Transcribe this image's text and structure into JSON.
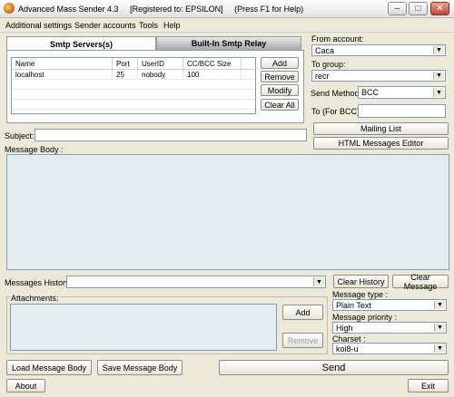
{
  "window": {
    "title": "Advanced Mass Sender 4.3     [Registered to: EPSILON]     (Press F1 for Help)",
    "min_glyph": "–",
    "max_glyph": "□",
    "close_glyph": "✕"
  },
  "menu": [
    "Additional settings",
    "Sender accounts",
    "Tools",
    "Help"
  ],
  "tabs": {
    "smtp_servers": "Smtp Servers(s)",
    "builtin_relay": "Built-In Smtp Relay"
  },
  "smtp_table": {
    "columns": [
      "Name",
      "Port",
      "UserID",
      "CC/BCC Size"
    ],
    "rows": [
      [
        "localhost",
        "25",
        "nobody",
        "100"
      ]
    ]
  },
  "smtp_buttons": {
    "add": "Add",
    "remove": "Remove",
    "modify": "Modify",
    "clear_all": "Clear All"
  },
  "right": {
    "from_account_label": "From account:",
    "from_account_value": "Caca",
    "to_group_label": "To group:",
    "to_group_value": "recr",
    "send_method_label": "Send Method:",
    "send_method_value": "BCC",
    "to_bcc_label": "To (For BCC):",
    "to_bcc_value": "",
    "mailing_list": "Mailing List",
    "html_editor": "HTML Messages Editor"
  },
  "subject": {
    "label": "Subject:",
    "value": ""
  },
  "message_body_label": "Message Body :",
  "history": {
    "label": "Messages History:",
    "value": "",
    "clear_history": "Clear History",
    "clear_message": "Clear Message"
  },
  "attachments": {
    "label": "Attachments:",
    "add": "Add",
    "remove": "Remove"
  },
  "message_type": {
    "label": "Message type :",
    "value": "Plain Text"
  },
  "message_priority": {
    "label": "Message priority :",
    "value": "High"
  },
  "charset": {
    "label": "Charset :",
    "value": "koi8-u"
  },
  "bottom": {
    "load": "Load Message Body",
    "save": "Save Message Body",
    "send": "Send",
    "about": "About",
    "exit": "Exit"
  },
  "icons": {
    "dropdown": "▼"
  }
}
